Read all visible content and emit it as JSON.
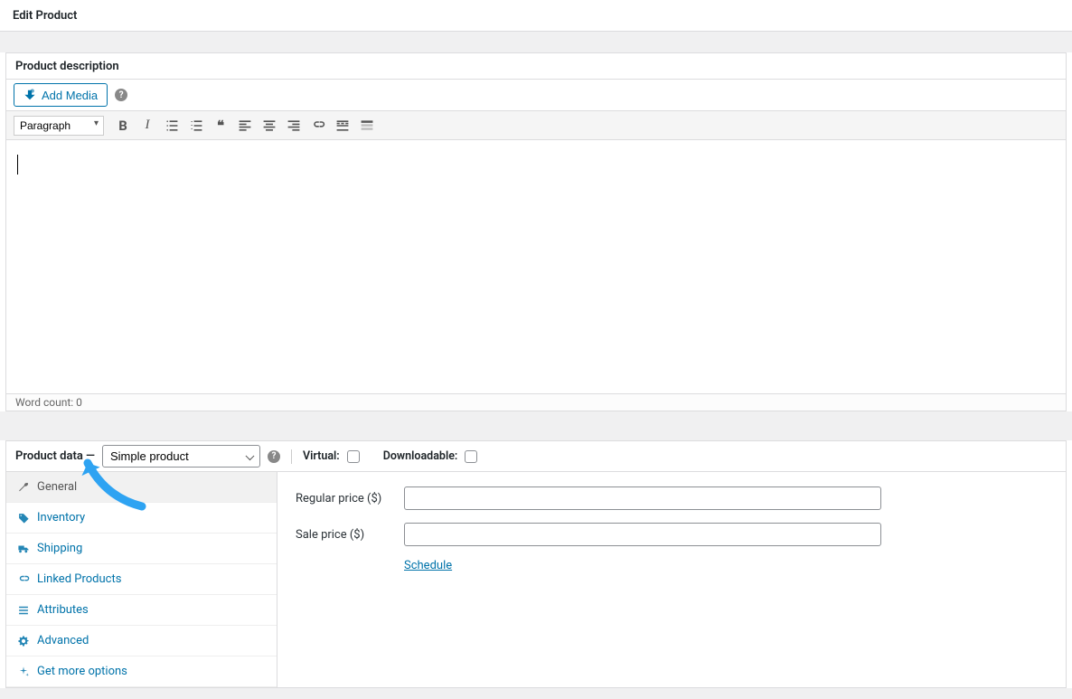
{
  "page_title": "Edit Product",
  "description_panel": {
    "title": "Product description",
    "add_media_label": "Add Media",
    "format_select": "Paragraph",
    "word_count_label": "Word count: 0"
  },
  "product_data": {
    "heading": "Product data —",
    "type_select": "Simple product",
    "virtual_label": "Virtual:",
    "downloadable_label": "Downloadable:",
    "tabs": [
      {
        "label": "General",
        "icon": "wrench-icon",
        "active": true
      },
      {
        "label": "Inventory",
        "icon": "tag-icon",
        "active": false
      },
      {
        "label": "Shipping",
        "icon": "truck-icon",
        "active": false
      },
      {
        "label": "Linked Products",
        "icon": "link-icon",
        "active": false
      },
      {
        "label": "Attributes",
        "icon": "list-icon",
        "active": false
      },
      {
        "label": "Advanced",
        "icon": "gear-icon",
        "active": false
      },
      {
        "label": "Get more options",
        "icon": "spark-icon",
        "active": false
      }
    ],
    "regular_price_label": "Regular price ($)",
    "sale_price_label": "Sale price ($)",
    "schedule_label": "Schedule"
  }
}
